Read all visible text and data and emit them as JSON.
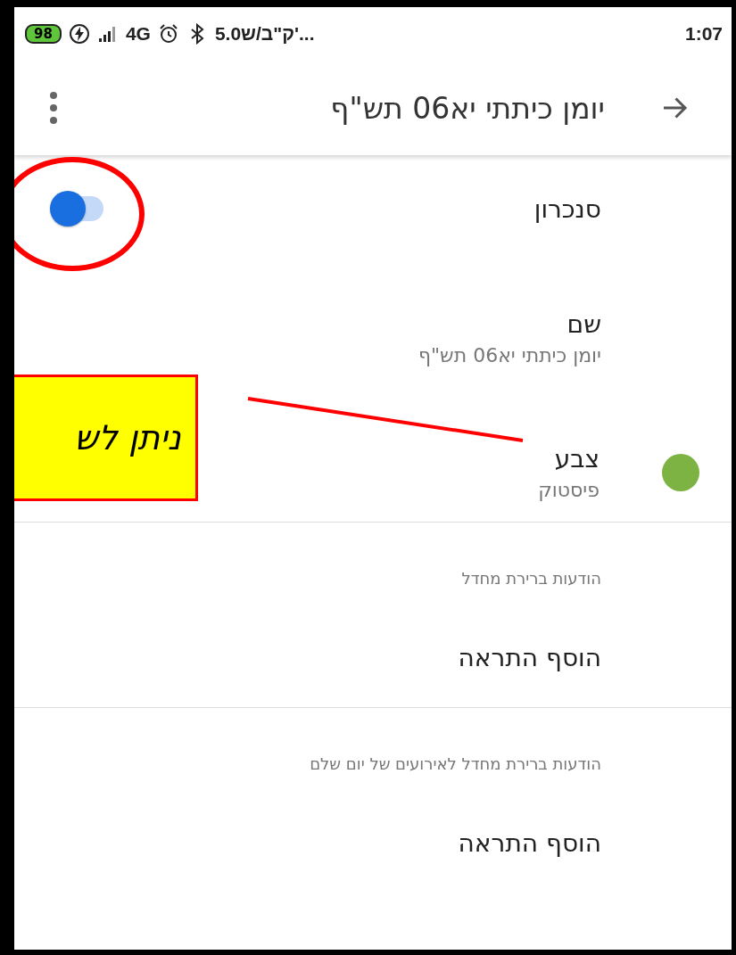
{
  "status_bar": {
    "battery": "98",
    "network": "4G",
    "speed": "5.0ק\"ב/ש'...",
    "time": "1:07"
  },
  "app_bar": {
    "title": "יומן כיתתי יא06 תש\"ף"
  },
  "settings": [
    {
      "kind": "toggle",
      "label": "סנכרון",
      "on": true
    },
    {
      "kind": "text",
      "label": "שם",
      "value": "יומן כיתתי יא06 תש\"ף"
    },
    {
      "kind": "color",
      "label": "צבע",
      "value": "פיסטוק",
      "color": "#7cb342"
    }
  ],
  "sections": [
    {
      "header": "הודעות ברירת מחדל",
      "action": "הוסף התראה"
    },
    {
      "header": "הודעות ברירת מחדל לאירועים של יום שלם",
      "action": "הוסף התראה"
    }
  ],
  "annotation": {
    "text": "ניתן לש"
  }
}
